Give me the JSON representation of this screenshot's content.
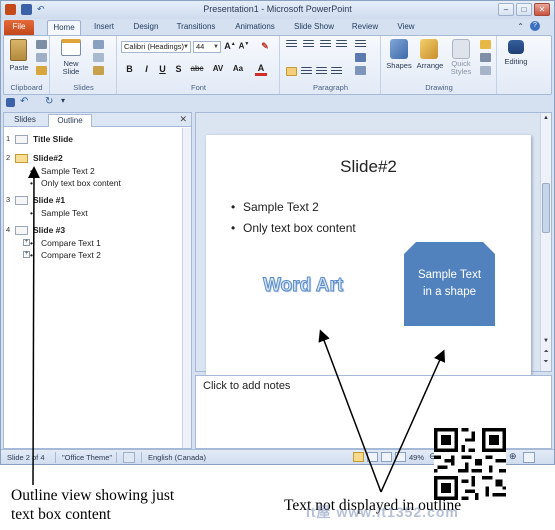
{
  "window": {
    "title": "Presentation1 - Microsoft PowerPoint",
    "controls": [
      "–",
      "□",
      "✕"
    ]
  },
  "ribbon_tabs": [
    "File",
    "Home",
    "Insert",
    "Design",
    "Transitions",
    "Animations",
    "Slide Show",
    "Review",
    "View"
  ],
  "active_tab": "Home",
  "ribbon": {
    "clipboard": {
      "label": "Clipboard",
      "paste": "Paste"
    },
    "slides": {
      "label": "Slides",
      "new_slide": "New Slide"
    },
    "font": {
      "label": "Font",
      "font_name": "Calibri (Headings)",
      "font_size": "44",
      "buttons": [
        "B",
        "I",
        "U",
        "S",
        "abc",
        "AV",
        "Aa",
        "A"
      ]
    },
    "paragraph": {
      "label": "Paragraph"
    },
    "drawing": {
      "label": "Drawing",
      "shapes": "Shapes",
      "arrange": "Arrange",
      "quick_styles": "Quick Styles"
    },
    "editing": {
      "label": "Editing"
    }
  },
  "pane_tabs": [
    "Slides",
    "Outline"
  ],
  "active_pane_tab": "Outline",
  "outline": [
    {
      "num": "1",
      "title": "Title Slide",
      "items": []
    },
    {
      "num": "2",
      "title": "Slide#2",
      "items": [
        "Sample Text 2",
        "Only text box content"
      ]
    },
    {
      "num": "3",
      "title": "Slide #1",
      "items": [
        "Sample Text"
      ]
    },
    {
      "num": "4",
      "title": "Slide #3",
      "items": [
        "Compare Text 1",
        "Compare Text 2"
      ]
    }
  ],
  "slide": {
    "title": "Slide#2",
    "bullets": [
      "Sample Text 2",
      "Only text box content"
    ],
    "word_art": "Word Art",
    "shape_text": "Sample Text in a shape"
  },
  "notes_placeholder": "Click to add notes",
  "status": {
    "slide_info": "Slide 2 of 4",
    "theme": "\"Office Theme\"",
    "language": "English (Canada)",
    "zoom": "49%"
  },
  "callouts": {
    "left": "Outline view showing just text box content",
    "right": "Text not displayed in outline"
  },
  "watermark": "It屋  www.it1352.com",
  "colors": {
    "file_tab": "#d4582a",
    "shape_fill": "#5182bd",
    "word_art_outline": "#5d8cc8",
    "selected_slide_icon": "#f7dd95"
  }
}
